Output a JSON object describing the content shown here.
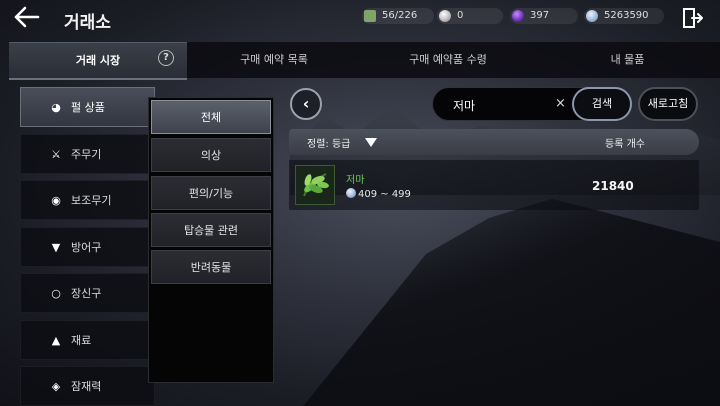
{
  "header": {
    "title": "거래소",
    "resources": [
      {
        "icon": "inventory-bag-icon",
        "value": "56/226"
      },
      {
        "icon": "pearl-icon",
        "value": "0"
      },
      {
        "icon": "purple-orb-icon",
        "value": "397"
      },
      {
        "icon": "silver-coin-icon",
        "value": "5263590"
      }
    ]
  },
  "tabs": [
    {
      "label": "거래 시장",
      "active": true
    },
    {
      "label": "구매 예약 목록",
      "active": false
    },
    {
      "label": "구매 예약품 수령",
      "active": false
    },
    {
      "label": "내 물품",
      "active": false
    }
  ],
  "help_label": "?",
  "categories": [
    {
      "label": "펄 상품",
      "icon": "pearl-item-icon",
      "active": true
    },
    {
      "label": "주무기",
      "icon": "crossed-swords-icon",
      "active": false
    },
    {
      "label": "보조무기",
      "icon": "shield-icon",
      "active": false
    },
    {
      "label": "방어구",
      "icon": "armor-icon",
      "active": false
    },
    {
      "label": "장신구",
      "icon": "ring-icon",
      "active": false
    },
    {
      "label": "재료",
      "icon": "potion-icon",
      "active": false
    },
    {
      "label": "잠재력",
      "icon": "diamond-icon",
      "active": false
    }
  ],
  "subcategories": [
    {
      "label": "전체",
      "active": true
    },
    {
      "label": "의상",
      "active": false
    },
    {
      "label": "편의/기능",
      "active": false
    },
    {
      "label": "탑승물 관련",
      "active": false
    },
    {
      "label": "반려동물",
      "active": false
    }
  ],
  "search": {
    "value": "저마",
    "clear_label": "×",
    "search_button": "검색",
    "refresh_button": "새로고침"
  },
  "list_header": {
    "sort_label": "정렬: 등급",
    "count_label": "등록 개수"
  },
  "items": [
    {
      "name": "저마",
      "price_range": "409 ~ 499",
      "count": "21840",
      "icon": "flax-plant-icon"
    }
  ],
  "colors": {
    "item_name": "#6fd05a",
    "active_tab": "#3b3f49"
  }
}
